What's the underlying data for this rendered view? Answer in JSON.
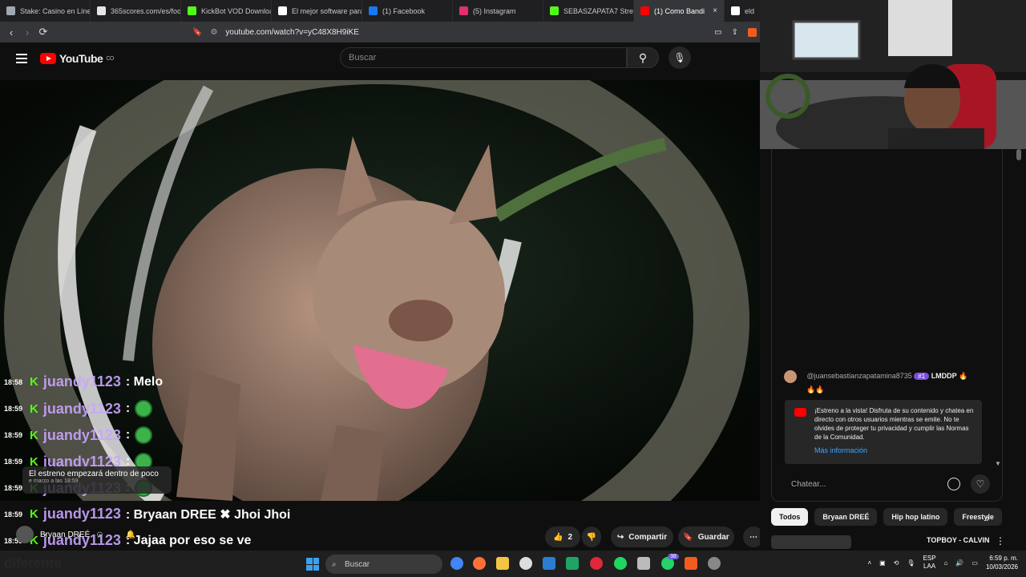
{
  "browser": {
    "tabs": [
      {
        "label": "Stake: Casino en Línea",
        "color": "#9fa8b2"
      },
      {
        "label": "365scores.com/es/foot",
        "color": "#e6e6e6"
      },
      {
        "label": "KickBot VOD Download",
        "color": "#53fc18"
      },
      {
        "label": "El mejor software para",
        "color": "#ffffff"
      },
      {
        "label": "(1) Facebook",
        "color": "#1877f2"
      },
      {
        "label": "(5) Instagram",
        "color": "#e1306c"
      },
      {
        "label": "SEBASZAPATA7 Stream",
        "color": "#53fc18"
      },
      {
        "label": "(1) Como Bandi",
        "color": "#ff0000"
      },
      {
        "label": "eld",
        "color": "#ffffff"
      }
    ],
    "url": "youtube.com/watch?v=yC48X8H9iKE"
  },
  "youtube": {
    "logo_text": "YouTube",
    "logo_region": "CO",
    "search_placeholder": "Buscar"
  },
  "overlay_chat": [
    {
      "time": "18:58",
      "user": "juandy1123",
      "msg": ": Melo",
      "emote": false
    },
    {
      "time": "18:59",
      "user": "juandy1123",
      "msg": ":",
      "emote": true
    },
    {
      "time": "18:59",
      "user": "juandy1123",
      "msg": ":",
      "emote": true
    },
    {
      "time": "18:59",
      "user": "juandy1123",
      "msg": ":",
      "emote": true
    },
    {
      "time": "18:59",
      "user": "juandy1123",
      "msg": ":",
      "emote": true
    },
    {
      "time": "18:59",
      "user": "juandy1123",
      "msg": ": Bryaan DREE ✖ Jhoi Jhoi",
      "emote": false
    },
    {
      "time": "18:59",
      "user": "juandy1123",
      "msg": ": Jajaa por eso se ve",
      "emote": false
    }
  ],
  "premiere_notice": {
    "text": "El estreno empezará dentro de poco",
    "subtext": "e marzo a las 18:59"
  },
  "bottom_title": "diferente",
  "channel_name": "Bryaan DREÉ",
  "actions": {
    "likes": "2",
    "share": "Compartir",
    "save": "Guardar"
  },
  "live_chat": {
    "message_user": "@juansebastianzapatamina8735",
    "message_badge": "#1",
    "message_text": "LMDDP 🔥",
    "message_line2": "🔥🔥",
    "notice_text": "¡Estreno a la vista! Disfruta de su contenido y chatea en directo con otros usuarios mientras se emite. No te olvides de proteger tu privacidad y cumplir las Normas de la Comunidad.",
    "notice_link": "Más información",
    "input_placeholder": "Chatear..."
  },
  "chips": [
    "Todos",
    "Bryaan DREÉ",
    "Hip hop latino",
    "Freestyle"
  ],
  "recommended_title": "TOPBOY - CALVIN",
  "taskbar": {
    "search_placeholder": "Buscar",
    "lang": "ESP",
    "lang2": "LAA",
    "time": "6:59 p. m.",
    "date": "10/03/2026",
    "badge_count": "38"
  }
}
